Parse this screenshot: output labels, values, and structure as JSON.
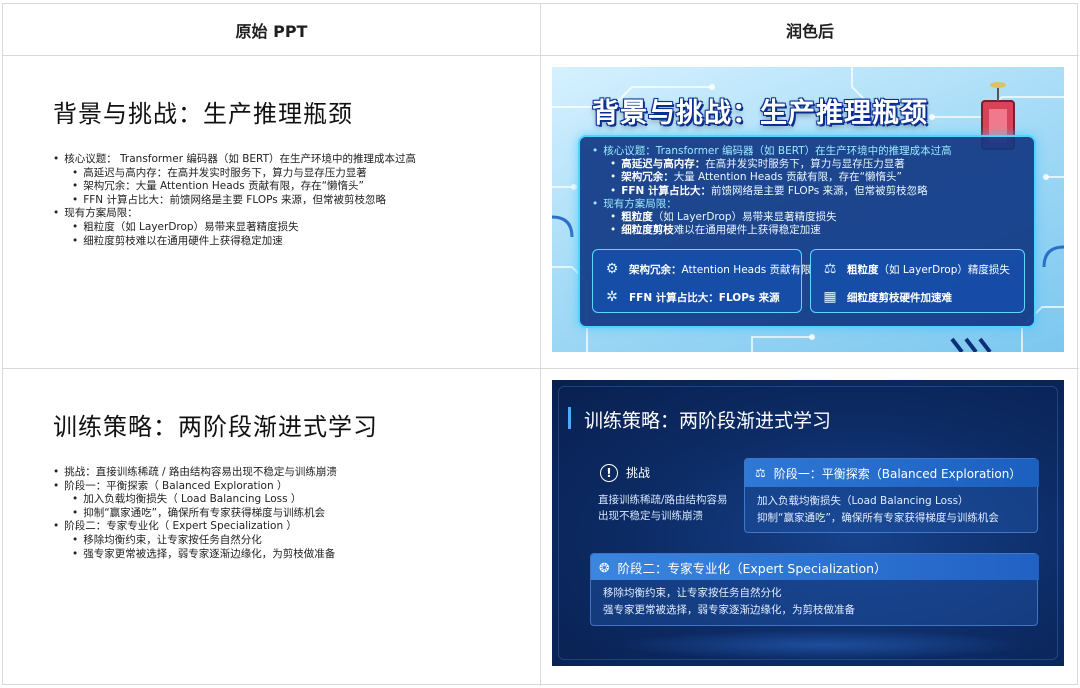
{
  "header": {
    "col_original": "原始 PPT",
    "col_polished": "润色后"
  },
  "slide1": {
    "original": {
      "title": "背景与挑战：生产推理瓶颈",
      "items": [
        "核心议题： Transformer 编码器（如 BERT）在生产环境中的推理成本过高",
        "高延迟与高内存：在高并发实时服务下，算力与显存压力显著",
        "架构冗余：大量 Attention Heads 贡献有限，存在“懒惰头”",
        "FFN 计算占比大：前馈网络是主要 FLOPs 来源，但常被剪枝忽略",
        "现有方案局限：",
        "粗粒度（如 LayerDrop）易带来显著精度损失",
        "细粒度剪枝难以在通用硬件上获得稳定加速"
      ]
    },
    "polished": {
      "title": "背景与挑战：生产推理瓶颈",
      "core_label": "核心议题：Transformer 编码器（如 BERT）在生产环境中的推理成本过高",
      "sub1_bold": "高延迟与高内存：",
      "sub1_text": "在高并发实时服务下，算力与显存压力显著",
      "sub2_bold": "架构冗余：",
      "sub2_text": "大量 Attention Heads 贡献有限，存在“懒惰头”",
      "sub3_bold": "FFN 计算占比大：",
      "sub3_text": "前馈网络是主要 FLOPs 来源，但常被剪枝忽略",
      "limit_label": "现有方案局限：",
      "sub4_bold": "粗粒度",
      "sub4_text": "（如 LayerDrop）易带来显著精度损失",
      "sub5_bold": "细粒度剪枝",
      "sub5_text": "难以在通用硬件上获得稳定加速",
      "card_a_row1_bold": "架构冗余：",
      "card_a_row1_text": "Attention Heads 贡献有限",
      "card_a_row2": "FFN 计算占比大：FLOPs 来源",
      "card_b_row1_bold": "粗粒度",
      "card_b_row1_text": "（如 LayerDrop）精度损失",
      "card_b_row2": "细粒度剪枝硬件加速难"
    }
  },
  "slide2": {
    "original": {
      "title": "训练策略：两阶段渐进式学习",
      "items": [
        "挑战：直接训练稀疏 / 路由结构容易出现不稳定与训练崩溃",
        "阶段一：平衡探索（ Balanced Exploration ）",
        "加入负载均衡损失（ Load Balancing Loss ）",
        "抑制“赢家通吃”，确保所有专家获得梯度与训练机会",
        "阶段二：专家专业化（ Expert Specialization ）",
        "移除均衡约束，让专家按任务自然分化",
        "强专家更常被选择，弱专家逐渐边缘化，为剪枝做准备"
      ]
    },
    "polished": {
      "title": "训练策略：两阶段渐进式学习",
      "challenge_label": "挑战",
      "challenge_line1": "直接训练稀疏/路由结构容易",
      "challenge_line2": "出现不稳定与训练崩溃",
      "stage1_title": "阶段一：平衡探索（Balanced Exploration）",
      "stage1_line1": "加入负载均衡损失（Load Balancing Loss）",
      "stage1_line2": "抑制“赢家通吃”，确保所有专家获得梯度与训练机会",
      "stage2_title": "阶段二：专家专业化（Expert Specialization）",
      "stage2_line1": "移除均衡约束，让专家按任务自然分化",
      "stage2_line2": "强专家更常被选择，弱专家逐渐边缘化，为剪枝做准备"
    }
  }
}
